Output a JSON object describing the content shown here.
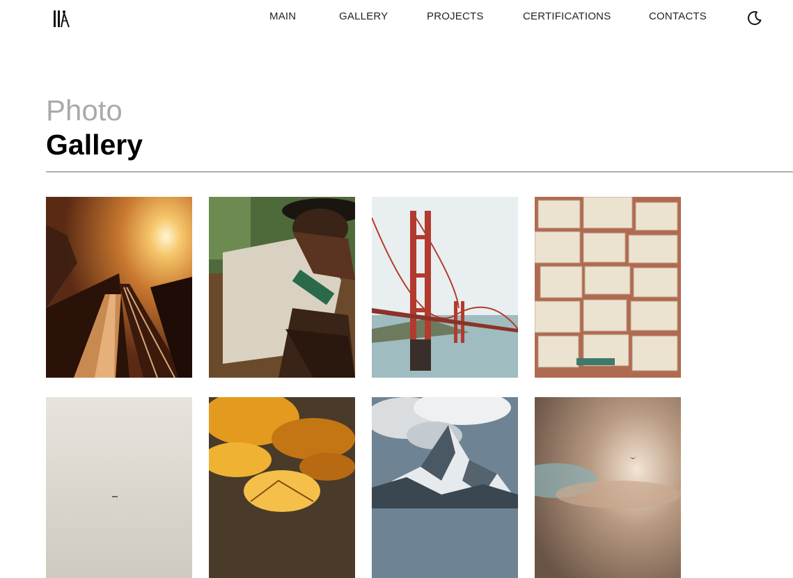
{
  "header": {
    "logo_icon": "architect-tools-icon",
    "nav": [
      {
        "label": "MAIN"
      },
      {
        "label": "GALLERY"
      },
      {
        "label": "PROJECTS"
      },
      {
        "label": "CERTIFICATIONS"
      },
      {
        "label": "CONTACTS"
      }
    ],
    "theme_toggle_icon": "moon-icon"
  },
  "page": {
    "title_light": "Photo",
    "title_bold": "Gallery"
  },
  "gallery": {
    "photos": [
      {
        "subject": "sunset over train tracks"
      },
      {
        "subject": "man in hat resting"
      },
      {
        "subject": "golden gate bridge"
      },
      {
        "subject": "open books"
      },
      {
        "subject": "foggy sky with plane"
      },
      {
        "subject": "autumn leaves"
      },
      {
        "subject": "snowy mountain peak"
      },
      {
        "subject": "cloudy sky with bird"
      }
    ]
  }
}
